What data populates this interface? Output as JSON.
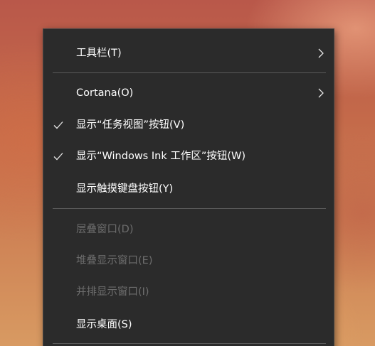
{
  "menu": {
    "items": [
      {
        "label": "工具栏(T)",
        "submenu": true,
        "checked": false,
        "disabled": false
      },
      {
        "label": "Cortana(O)",
        "submenu": true,
        "checked": false,
        "disabled": false
      },
      {
        "label": "显示“任务视图”按钮(V)",
        "submenu": false,
        "checked": true,
        "disabled": false
      },
      {
        "label": "显示“Windows Ink 工作区”按钮(W)",
        "submenu": false,
        "checked": true,
        "disabled": false
      },
      {
        "label": "显示触摸键盘按钮(Y)",
        "submenu": false,
        "checked": false,
        "disabled": false
      },
      {
        "label": "层叠窗口(D)",
        "submenu": false,
        "checked": false,
        "disabled": true
      },
      {
        "label": "堆叠显示窗口(E)",
        "submenu": false,
        "checked": false,
        "disabled": true
      },
      {
        "label": "并排显示窗口(I)",
        "submenu": false,
        "checked": false,
        "disabled": true
      },
      {
        "label": "显示桌面(S)",
        "submenu": false,
        "checked": false,
        "disabled": false
      }
    ]
  },
  "colors": {
    "menu_background": "#2b2b2b",
    "text": "#ffffff",
    "disabled_text": "#6d6d6d",
    "separator": "#5a5a5a"
  },
  "icons": {
    "check": "check-icon",
    "submenu": "chevron-right-icon"
  }
}
